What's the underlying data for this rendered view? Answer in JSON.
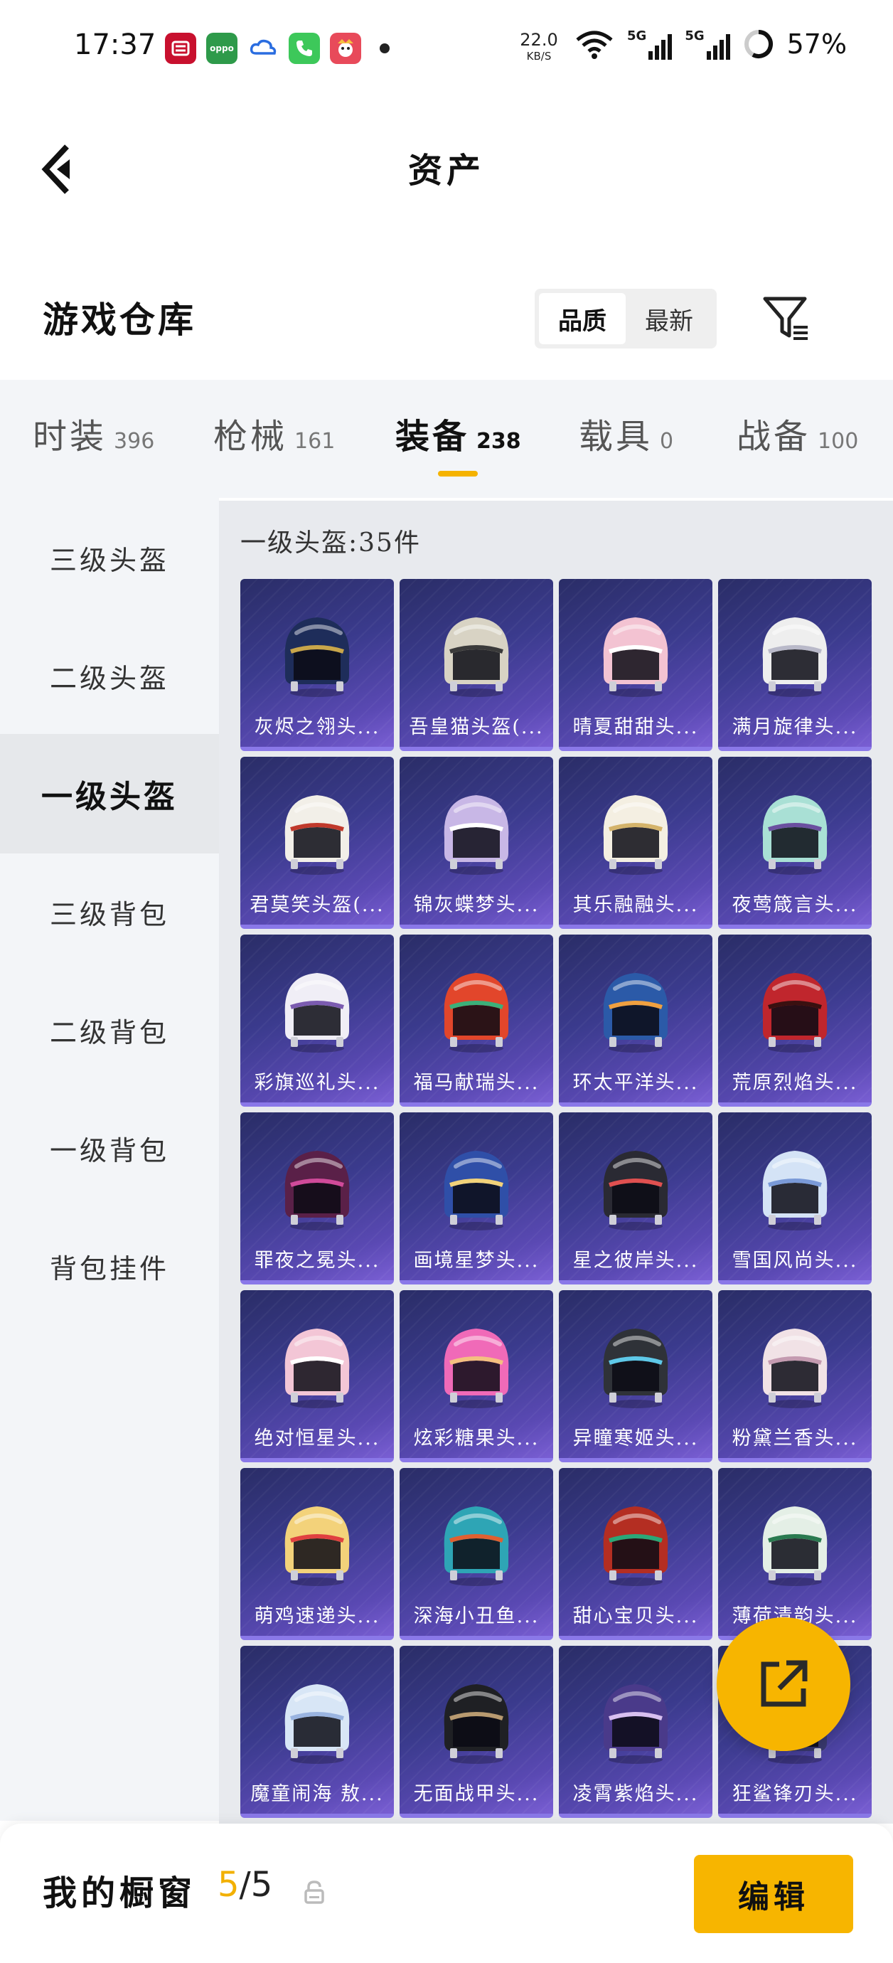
{
  "status_bar": {
    "time": "17:37",
    "net_speed_value": "22.0",
    "net_speed_unit": "KB/S",
    "battery": "57%",
    "notification_icons": [
      "china-post-icon",
      "oppo-icon",
      "cloud-icon",
      "phone-icon",
      "game-app-icon"
    ],
    "oppo_text": "oppo",
    "signal_labels": [
      "5G",
      "5G"
    ]
  },
  "header": {
    "title": "资产"
  },
  "warehouse": {
    "title": "游戏仓库",
    "sort_options": [
      "品质",
      "最新"
    ],
    "active_sort": "品质"
  },
  "tabs": [
    {
      "label": "时装",
      "count": "396"
    },
    {
      "label": "枪械",
      "count": "161"
    },
    {
      "label": "装备",
      "count": "238"
    },
    {
      "label": "载具",
      "count": "0"
    },
    {
      "label": "战备",
      "count": "100"
    }
  ],
  "sidebar": [
    {
      "label": "三级头盔"
    },
    {
      "label": "二级头盔"
    },
    {
      "label": "一级头盔"
    },
    {
      "label": "三级背包"
    },
    {
      "label": "二级背包"
    },
    {
      "label": "一级背包"
    },
    {
      "label": "背包挂件"
    }
  ],
  "grid": {
    "heading": "一级头盔:35件",
    "items": [
      {
        "label": "灰烬之翎头...",
        "color": "#1e2d5a",
        "accent": "#c9a64a"
      },
      {
        "label": "吾皇猫头盔(...",
        "color": "#d8d3c4",
        "accent": "#3a3a3a"
      },
      {
        "label": "晴夏甜甜头...",
        "color": "#f3c3d2",
        "accent": "#ffffff"
      },
      {
        "label": "满月旋律头...",
        "color": "#eeeeee",
        "accent": "#b9b9c9"
      },
      {
        "label": "君莫笑头盔(...",
        "color": "#f2efe8",
        "accent": "#c0392b"
      },
      {
        "label": "锦灰蝶梦头...",
        "color": "#c8b7e6",
        "accent": "#ffffff"
      },
      {
        "label": "其乐融融头...",
        "color": "#f4efe2",
        "accent": "#d4b36a"
      },
      {
        "label": "夜莺箴言头...",
        "color": "#a9e0d5",
        "accent": "#6b4fa0"
      },
      {
        "label": "彩旗巡礼头...",
        "color": "#f0eef6",
        "accent": "#7b5bb0"
      },
      {
        "label": "福马献瑞头...",
        "color": "#e2462b",
        "accent": "#3bb07a"
      },
      {
        "label": "环太平洋头...",
        "color": "#2b5aa8",
        "accent": "#f0a040"
      },
      {
        "label": "荒原烈焰头...",
        "color": "#c0262d",
        "accent": "#3a1010"
      },
      {
        "label": "罪夜之冕头...",
        "color": "#5a2048",
        "accent": "#d04a9a"
      },
      {
        "label": "画境星梦头...",
        "color": "#2f4fa8",
        "accent": "#f2d27a"
      },
      {
        "label": "星之彼岸头...",
        "color": "#2a2a33",
        "accent": "#e05050"
      },
      {
        "label": "雪国风尚头...",
        "color": "#d4e3f6",
        "accent": "#7a9ad8"
      },
      {
        "label": "绝对恒星头...",
        "color": "#f3c6d6",
        "accent": "#ffffff"
      },
      {
        "label": "炫彩糖果头...",
        "color": "#f06ab8",
        "accent": "#f4c080"
      },
      {
        "label": "异瞳寒姬头...",
        "color": "#2f3238",
        "accent": "#5ec8e8"
      },
      {
        "label": "粉黛兰香头...",
        "color": "#f1e2e6",
        "accent": "#c49ab0"
      },
      {
        "label": "萌鸡速递头...",
        "color": "#f3d27a",
        "accent": "#e04040"
      },
      {
        "label": "深海小丑鱼...",
        "color": "#2ea5b5",
        "accent": "#e06030"
      },
      {
        "label": "甜心宝贝头...",
        "color": "#b42e22",
        "accent": "#2aa878"
      },
      {
        "label": "薄荷清韵头...",
        "color": "#e4efe6",
        "accent": "#2a7a50"
      },
      {
        "label": "魔童闹海 敖...",
        "color": "#d8e6f6",
        "accent": "#9ab4e0"
      },
      {
        "label": "无面战甲头...",
        "color": "#1f2024",
        "accent": "#b89a70"
      },
      {
        "label": "凌霄紫焰头...",
        "color": "#4a3a8a",
        "accent": "#d8c0f0"
      },
      {
        "label": "狂鲨锋刃头...",
        "color": "#3a3a70",
        "accent": "#aab0d0"
      }
    ]
  },
  "showcase": {
    "label": "我的橱窗",
    "current": "5",
    "separator_total": "/5",
    "edit_label": "编辑"
  },
  "colors": {
    "accent": "#f7b500",
    "card_gradient_top": "#2a2d67",
    "card_gradient_bottom": "#7a5fd4"
  }
}
